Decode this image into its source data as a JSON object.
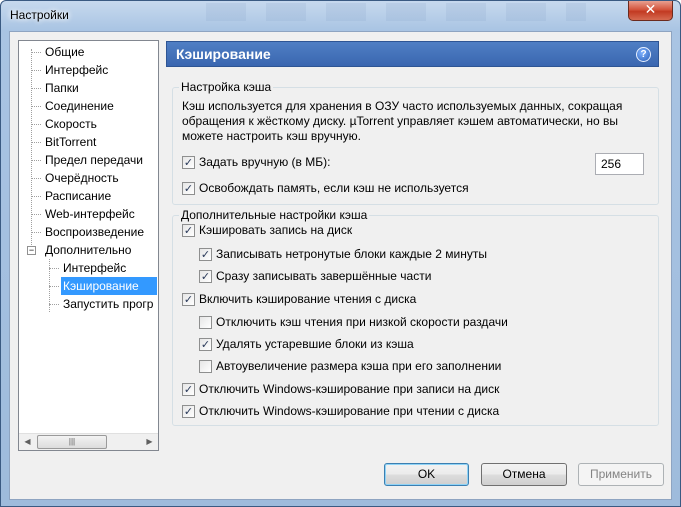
{
  "window": {
    "title": "Настройки",
    "close_glyph": "✕"
  },
  "tree": {
    "items": [
      {
        "label": "Общие"
      },
      {
        "label": "Интерфейс"
      },
      {
        "label": "Папки"
      },
      {
        "label": "Соединение"
      },
      {
        "label": "Скорость"
      },
      {
        "label": "BitTorrent"
      },
      {
        "label": "Предел передачи"
      },
      {
        "label": "Очерёдность"
      },
      {
        "label": "Расписание"
      },
      {
        "label": "Web-интерфейс"
      },
      {
        "label": "Воспроизведение"
      },
      {
        "label": "Дополнительно"
      },
      {
        "label": "Интерфейс"
      },
      {
        "label": "Кэширование"
      },
      {
        "label": "Запустить прогр"
      }
    ],
    "expander_symbol": "−",
    "selected": "Кэширование",
    "scroll_left": "◀",
    "scroll_right": "▶",
    "scroll_grip": "|||"
  },
  "panel": {
    "title": "Кэширование",
    "help_glyph": "?",
    "cache_settings": {
      "label": "Настройка кэша",
      "description": [
        "Кэш используется для хранения в ОЗУ часто используемых данных, сокращая",
        "обращения к жёсткому диску. µTorrent управляет кэшем автоматически, но вы",
        "можете настроить кэш вручную."
      ],
      "manual_label": "Задать вручную (в МБ):",
      "manual_checked": true,
      "manual_value": "256",
      "free_memory_label": "Освобождать память, если кэш не используется",
      "free_memory_checked": true
    },
    "advanced": {
      "label": "Дополнительные настройки кэша",
      "options": [
        {
          "label": "Кэшировать запись на диск",
          "checked": true
        },
        {
          "label": "Записывать нетронутые блоки каждые 2 минуты",
          "checked": true
        },
        {
          "label": "Сразу записывать завершённые части",
          "checked": true
        },
        {
          "label": "Включить кэширование чтения с диска",
          "checked": true
        },
        {
          "label": "Отключить кэш чтения при низкой скорости раздачи",
          "checked": false
        },
        {
          "label": "Удалять устаревшие блоки из кэша",
          "checked": true
        },
        {
          "label": "Автоувеличение размера кэша при его заполнении",
          "checked": false
        },
        {
          "label": "Отключить Windows-кэширование при записи на диск",
          "checked": true
        },
        {
          "label": "Отключить Windows-кэширование при чтении с диска",
          "checked": true
        }
      ]
    }
  },
  "buttons": {
    "ok": "OK",
    "cancel": "Отмена",
    "apply": "Применить"
  },
  "check_glyph": "✓"
}
